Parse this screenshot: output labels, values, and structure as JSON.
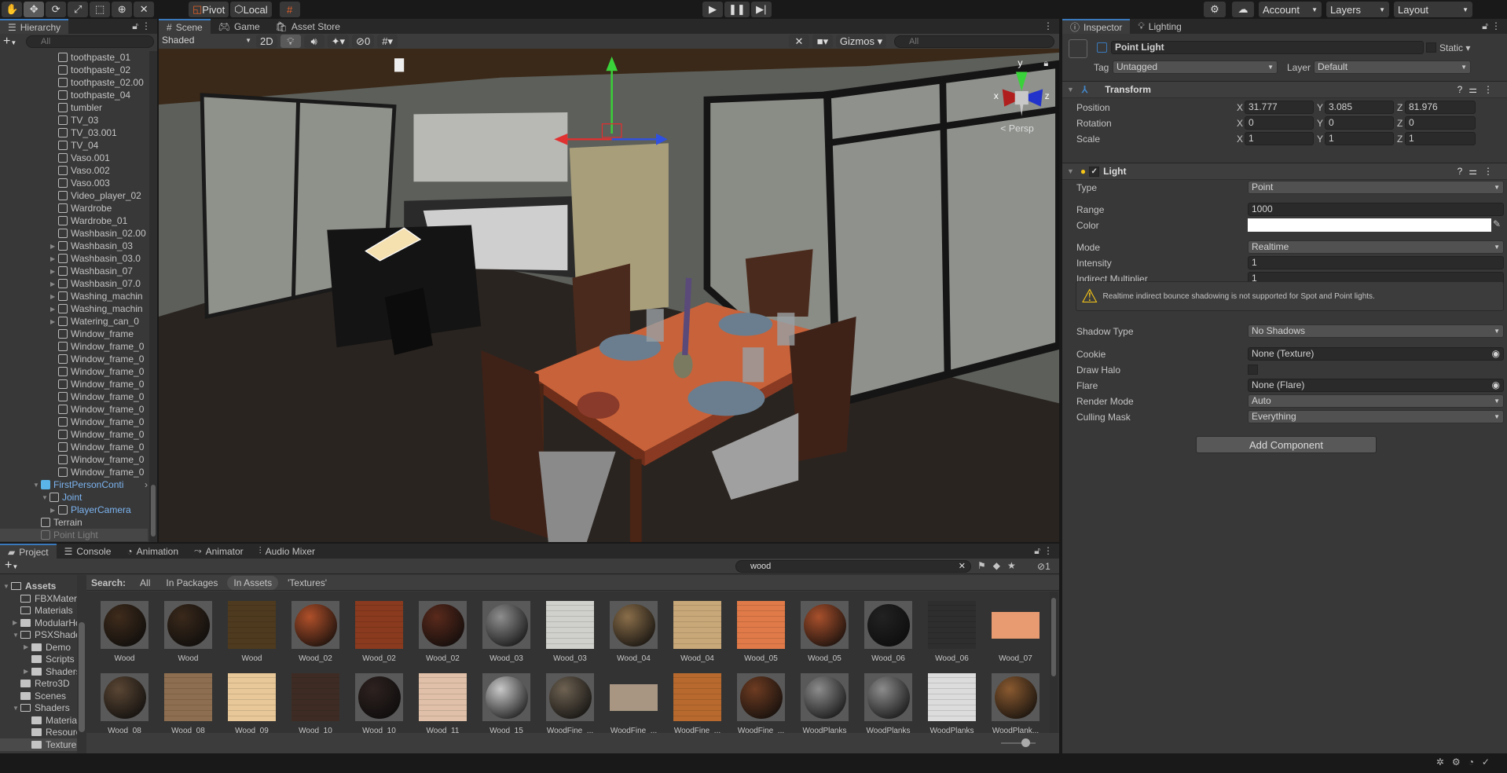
{
  "toolbar": {
    "tools": [
      "hand",
      "move",
      "rotate",
      "scale",
      "rect",
      "transform",
      "custom"
    ],
    "pivot": "Pivot",
    "local": "Local",
    "account": "Account",
    "layers": "Layers",
    "layout": "Layout"
  },
  "hierarchy": {
    "title": "Hierarchy",
    "search_placeholder": "All",
    "items": [
      {
        "label": "toothpaste_01",
        "depth": 2
      },
      {
        "label": "toothpaste_02",
        "depth": 2
      },
      {
        "label": "toothpaste_02.00",
        "depth": 2
      },
      {
        "label": "toothpaste_04",
        "depth": 2
      },
      {
        "label": "tumbler",
        "depth": 2
      },
      {
        "label": "TV_03",
        "depth": 2
      },
      {
        "label": "TV_03.001",
        "depth": 2
      },
      {
        "label": "TV_04",
        "depth": 2
      },
      {
        "label": "Vaso.001",
        "depth": 2
      },
      {
        "label": "Vaso.002",
        "depth": 2
      },
      {
        "label": "Vaso.003",
        "depth": 2
      },
      {
        "label": "Video_player_02",
        "depth": 2
      },
      {
        "label": "Wardrobe",
        "depth": 2
      },
      {
        "label": "Wardrobe_01",
        "depth": 2
      },
      {
        "label": "Washbasin_02.00",
        "depth": 2
      },
      {
        "label": "Washbasin_03",
        "depth": 2,
        "arrow": "right"
      },
      {
        "label": "Washbasin_03.0",
        "depth": 2,
        "arrow": "right"
      },
      {
        "label": "Washbasin_07",
        "depth": 2,
        "arrow": "right"
      },
      {
        "label": "Washbasin_07.0",
        "depth": 2,
        "arrow": "right"
      },
      {
        "label": "Washing_machin",
        "depth": 2,
        "arrow": "right"
      },
      {
        "label": "Washing_machin",
        "depth": 2,
        "arrow": "right"
      },
      {
        "label": "Watering_can_0",
        "depth": 2,
        "arrow": "right"
      },
      {
        "label": "Window_frame",
        "depth": 2
      },
      {
        "label": "Window_frame_0",
        "depth": 2
      },
      {
        "label": "Window_frame_0",
        "depth": 2
      },
      {
        "label": "Window_frame_0",
        "depth": 2
      },
      {
        "label": "Window_frame_0",
        "depth": 2
      },
      {
        "label": "Window_frame_0",
        "depth": 2
      },
      {
        "label": "Window_frame_0",
        "depth": 2
      },
      {
        "label": "Window_frame_0",
        "depth": 2
      },
      {
        "label": "Window_frame_0",
        "depth": 2
      },
      {
        "label": "Window_frame_0",
        "depth": 2
      },
      {
        "label": "Window_frame_0",
        "depth": 2
      },
      {
        "label": "Window_frame_0",
        "depth": 2
      },
      {
        "label": "FirstPersonConti",
        "depth": 0,
        "arrow": "down",
        "prefab": true
      },
      {
        "label": "Joint",
        "depth": 1,
        "arrow": "down",
        "prefab": true
      },
      {
        "label": "PlayerCamera",
        "depth": 2,
        "arrow": "right",
        "prefab": true
      },
      {
        "label": "Terrain",
        "depth": 0
      },
      {
        "label": "Point Light",
        "depth": 0,
        "selected": true,
        "inactive": true
      }
    ]
  },
  "scene": {
    "tabs": [
      "Scene",
      "Game",
      "Asset Store"
    ],
    "shading": "Shaded",
    "mode_2d": "2D",
    "hidden_count": "0",
    "gizmos": "Gizmos",
    "search_placeholder": "All",
    "persp": "Persp",
    "axes": {
      "x": "x",
      "y": "y",
      "z": "z"
    }
  },
  "inspector": {
    "tabs": [
      "Inspector",
      "Lighting"
    ],
    "object_name": "Point Light",
    "active": false,
    "static_label": "Static",
    "tag_label": "Tag",
    "tag": "Untagged",
    "layer_label": "Layer",
    "layer": "Default",
    "transform": {
      "title": "Transform",
      "rows": [
        {
          "label": "Position",
          "x": "31.777",
          "y": "3.085",
          "z": "81.976"
        },
        {
          "label": "Rotation",
          "x": "0",
          "y": "0",
          "z": "0"
        },
        {
          "label": "Scale",
          "x": "1",
          "y": "1",
          "z": "1"
        }
      ]
    },
    "light": {
      "title": "Light",
      "enabled": true,
      "type_label": "Type",
      "type": "Point",
      "range_label": "Range",
      "range": "1000",
      "color_label": "Color",
      "color": "#ffffff",
      "mode_label": "Mode",
      "mode": "Realtime",
      "intensity_label": "Intensity",
      "intensity": "1",
      "indirect_label": "Indirect Multiplier",
      "indirect": "1",
      "warning": "Realtime indirect bounce shadowing is not supported for Spot and Point lights.",
      "shadow_label": "Shadow Type",
      "shadow": "No Shadows",
      "cookie_label": "Cookie",
      "cookie": "None (Texture)",
      "halo_label": "Draw Halo",
      "halo": false,
      "flare_label": "Flare",
      "flare": "None (Flare)",
      "render_label": "Render Mode",
      "render": "Auto",
      "culling_label": "Culling Mask",
      "culling": "Everything"
    },
    "add_component": "Add Component"
  },
  "project": {
    "tabs": [
      "Project",
      "Console",
      "Animation",
      "Animator",
      "Audio Mixer"
    ],
    "search_value": "wood",
    "hidden_count": "1",
    "search_label": "Search:",
    "filters": [
      "All",
      "In Packages",
      "In Assets",
      "'Textures'"
    ],
    "active_filter": "In Assets",
    "tree": [
      {
        "label": "Assets",
        "depth": 0,
        "arrow": "down",
        "open": true,
        "bold": true
      },
      {
        "label": "FBXMaterials",
        "depth": 1,
        "open": true
      },
      {
        "label": "Materials",
        "depth": 1,
        "open": true
      },
      {
        "label": "ModularHouse",
        "depth": 1,
        "arrow": "right"
      },
      {
        "label": "PSXShaders",
        "depth": 1,
        "arrow": "down",
        "open": true
      },
      {
        "label": "Demo",
        "depth": 2,
        "arrow": "right"
      },
      {
        "label": "Scripts",
        "depth": 2
      },
      {
        "label": "Shaders",
        "depth": 2,
        "arrow": "right"
      },
      {
        "label": "Retro3D",
        "depth": 1
      },
      {
        "label": "Scenes",
        "depth": 1
      },
      {
        "label": "Shaders",
        "depth": 1,
        "arrow": "down",
        "open": true
      },
      {
        "label": "Materials",
        "depth": 2
      },
      {
        "label": "Resources",
        "depth": 2
      },
      {
        "label": "Textures",
        "depth": 2,
        "selected": true
      }
    ],
    "assets": [
      {
        "name": "Wood",
        "kind": "sphere",
        "color": "#3f2c1c"
      },
      {
        "name": "Wood",
        "kind": "sphere",
        "color": "#3a291b"
      },
      {
        "name": "Wood",
        "kind": "texture",
        "color": "#4e3a1e"
      },
      {
        "name": "Wood_02",
        "kind": "sphere",
        "color": "#b0502a"
      },
      {
        "name": "Wood_02",
        "kind": "texture",
        "color": "#8a3a1e"
      },
      {
        "name": "Wood_02",
        "kind": "sphere",
        "color": "#5a2a1c"
      },
      {
        "name": "Wood_03",
        "kind": "sphere",
        "color": "#8e8e8e"
      },
      {
        "name": "Wood_03",
        "kind": "texture",
        "color": "#d0d0cc"
      },
      {
        "name": "Wood_04",
        "kind": "sphere",
        "color": "#8a6e4a"
      },
      {
        "name": "Wood_04",
        "kind": "texture",
        "color": "#c8a878"
      },
      {
        "name": "Wood_05",
        "kind": "texture",
        "color": "#e07a48"
      },
      {
        "name": "Wood_05",
        "kind": "sphere",
        "color": "#a8502c"
      },
      {
        "name": "Wood_06",
        "kind": "sphere",
        "color": "#222222"
      },
      {
        "name": "Wood_06",
        "kind": "texture",
        "color": "#2e2e2e"
      },
      {
        "name": "Wood_07",
        "kind": "wide",
        "color": "#e89a70"
      },
      {
        "name": "Wood_08",
        "kind": "sphere",
        "color": "#5a4634"
      },
      {
        "name": "Wood_08",
        "kind": "texture",
        "color": "#8e6e50"
      },
      {
        "name": "Wood_09",
        "kind": "texture",
        "color": "#e8c898"
      },
      {
        "name": "Wood_10",
        "kind": "texture",
        "color": "#3e2c24"
      },
      {
        "name": "Wood_10",
        "kind": "sphere",
        "color": "#2e2220"
      },
      {
        "name": "Wood_11",
        "kind": "texture",
        "color": "#e0c0a8"
      },
      {
        "name": "Wood_15",
        "kind": "sphere",
        "color": "#c8c8c8"
      },
      {
        "name": "WoodFine_...",
        "kind": "sphere",
        "color": "#6e6252"
      },
      {
        "name": "WoodFine_...",
        "kind": "wide",
        "color": "#a89682"
      },
      {
        "name": "WoodFine_...",
        "kind": "texture",
        "color": "#b86a2e"
      },
      {
        "name": "WoodFine_...",
        "kind": "sphere",
        "color": "#6e3c22"
      },
      {
        "name": "WoodPlanks",
        "kind": "sphere",
        "color": "#8c8c8c"
      },
      {
        "name": "WoodPlanks",
        "kind": "sphere",
        "color": "#8c8c8c"
      },
      {
        "name": "WoodPlanks",
        "kind": "texture",
        "color": "#dcdcdc"
      },
      {
        "name": "WoodPlank...",
        "kind": "sphere",
        "color": "#8a5a30"
      }
    ]
  },
  "colors": {
    "accent": "#3a79bb",
    "prefab": "#7cb4f0",
    "warning": "#f5c518"
  }
}
